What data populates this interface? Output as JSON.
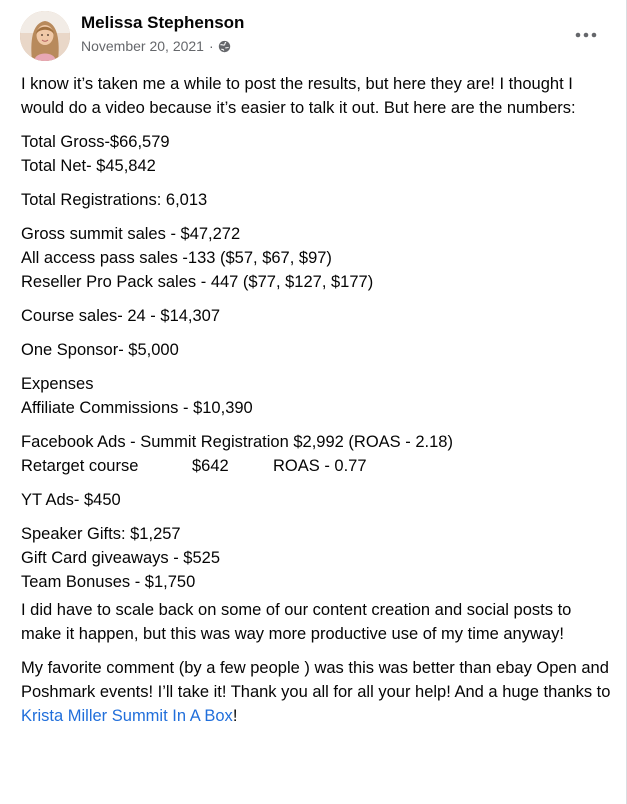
{
  "author": {
    "name": "Melissa Stephenson",
    "date": "November 20, 2021",
    "separator": "·",
    "privacy_icon": "globe-icon"
  },
  "menu": {
    "icon": "more-horizontal-icon"
  },
  "post": {
    "intro": "I know it’s taken me a while to post the results, but here they are! I thought I would do a video because it’s easier to talk it out. But here are the numbers:",
    "total_gross": "Total Gross-$66,579",
    "total_net": "Total Net- $45,842",
    "registrations": "Total Registrations: 6,013",
    "gross_summit": "Gross summit sales - $47,272",
    "all_access": "All access pass sales -133 ($57, $67, $97)",
    "reseller": "Reseller Pro Pack sales - 447 ($77, $127, $177)",
    "course_sales": "Course sales- 24 - $14,307",
    "sponsor": "One Sponsor- $5,000",
    "expenses": "Expenses",
    "affiliate": "Affiliate Commissions - $10,390",
    "fb_ads": "Facebook Ads - Summit Registration  $2,992 (ROAS - 2.18)",
    "retarget_label": "Retarget course",
    "retarget_amount": "$642",
    "retarget_roas": "ROAS - 0.77",
    "yt_ads": "YT Ads- $450",
    "speaker_gifts": "Speaker Gifts: $1,257",
    "gift_card": "Gift Card giveaways - $525",
    "team_bonuses": "Team Bonuses - $1,750",
    "scale_back": "I did have to scale back on some of our content creation and social posts to make it happen, but this was way more productive use of my time anyway!",
    "favorite_prefix": "My favorite comment (by a few people ) was this was better than ebay Open and Poshmark events! I’ll take it! Thank you all for all your help! And a huge thanks to ",
    "mention": "Krista Miller Summit In A Box",
    "favorite_suffix": "!"
  },
  "colors": {
    "text": "#050505",
    "secondary": "#65676b",
    "link": "#216fdb"
  }
}
